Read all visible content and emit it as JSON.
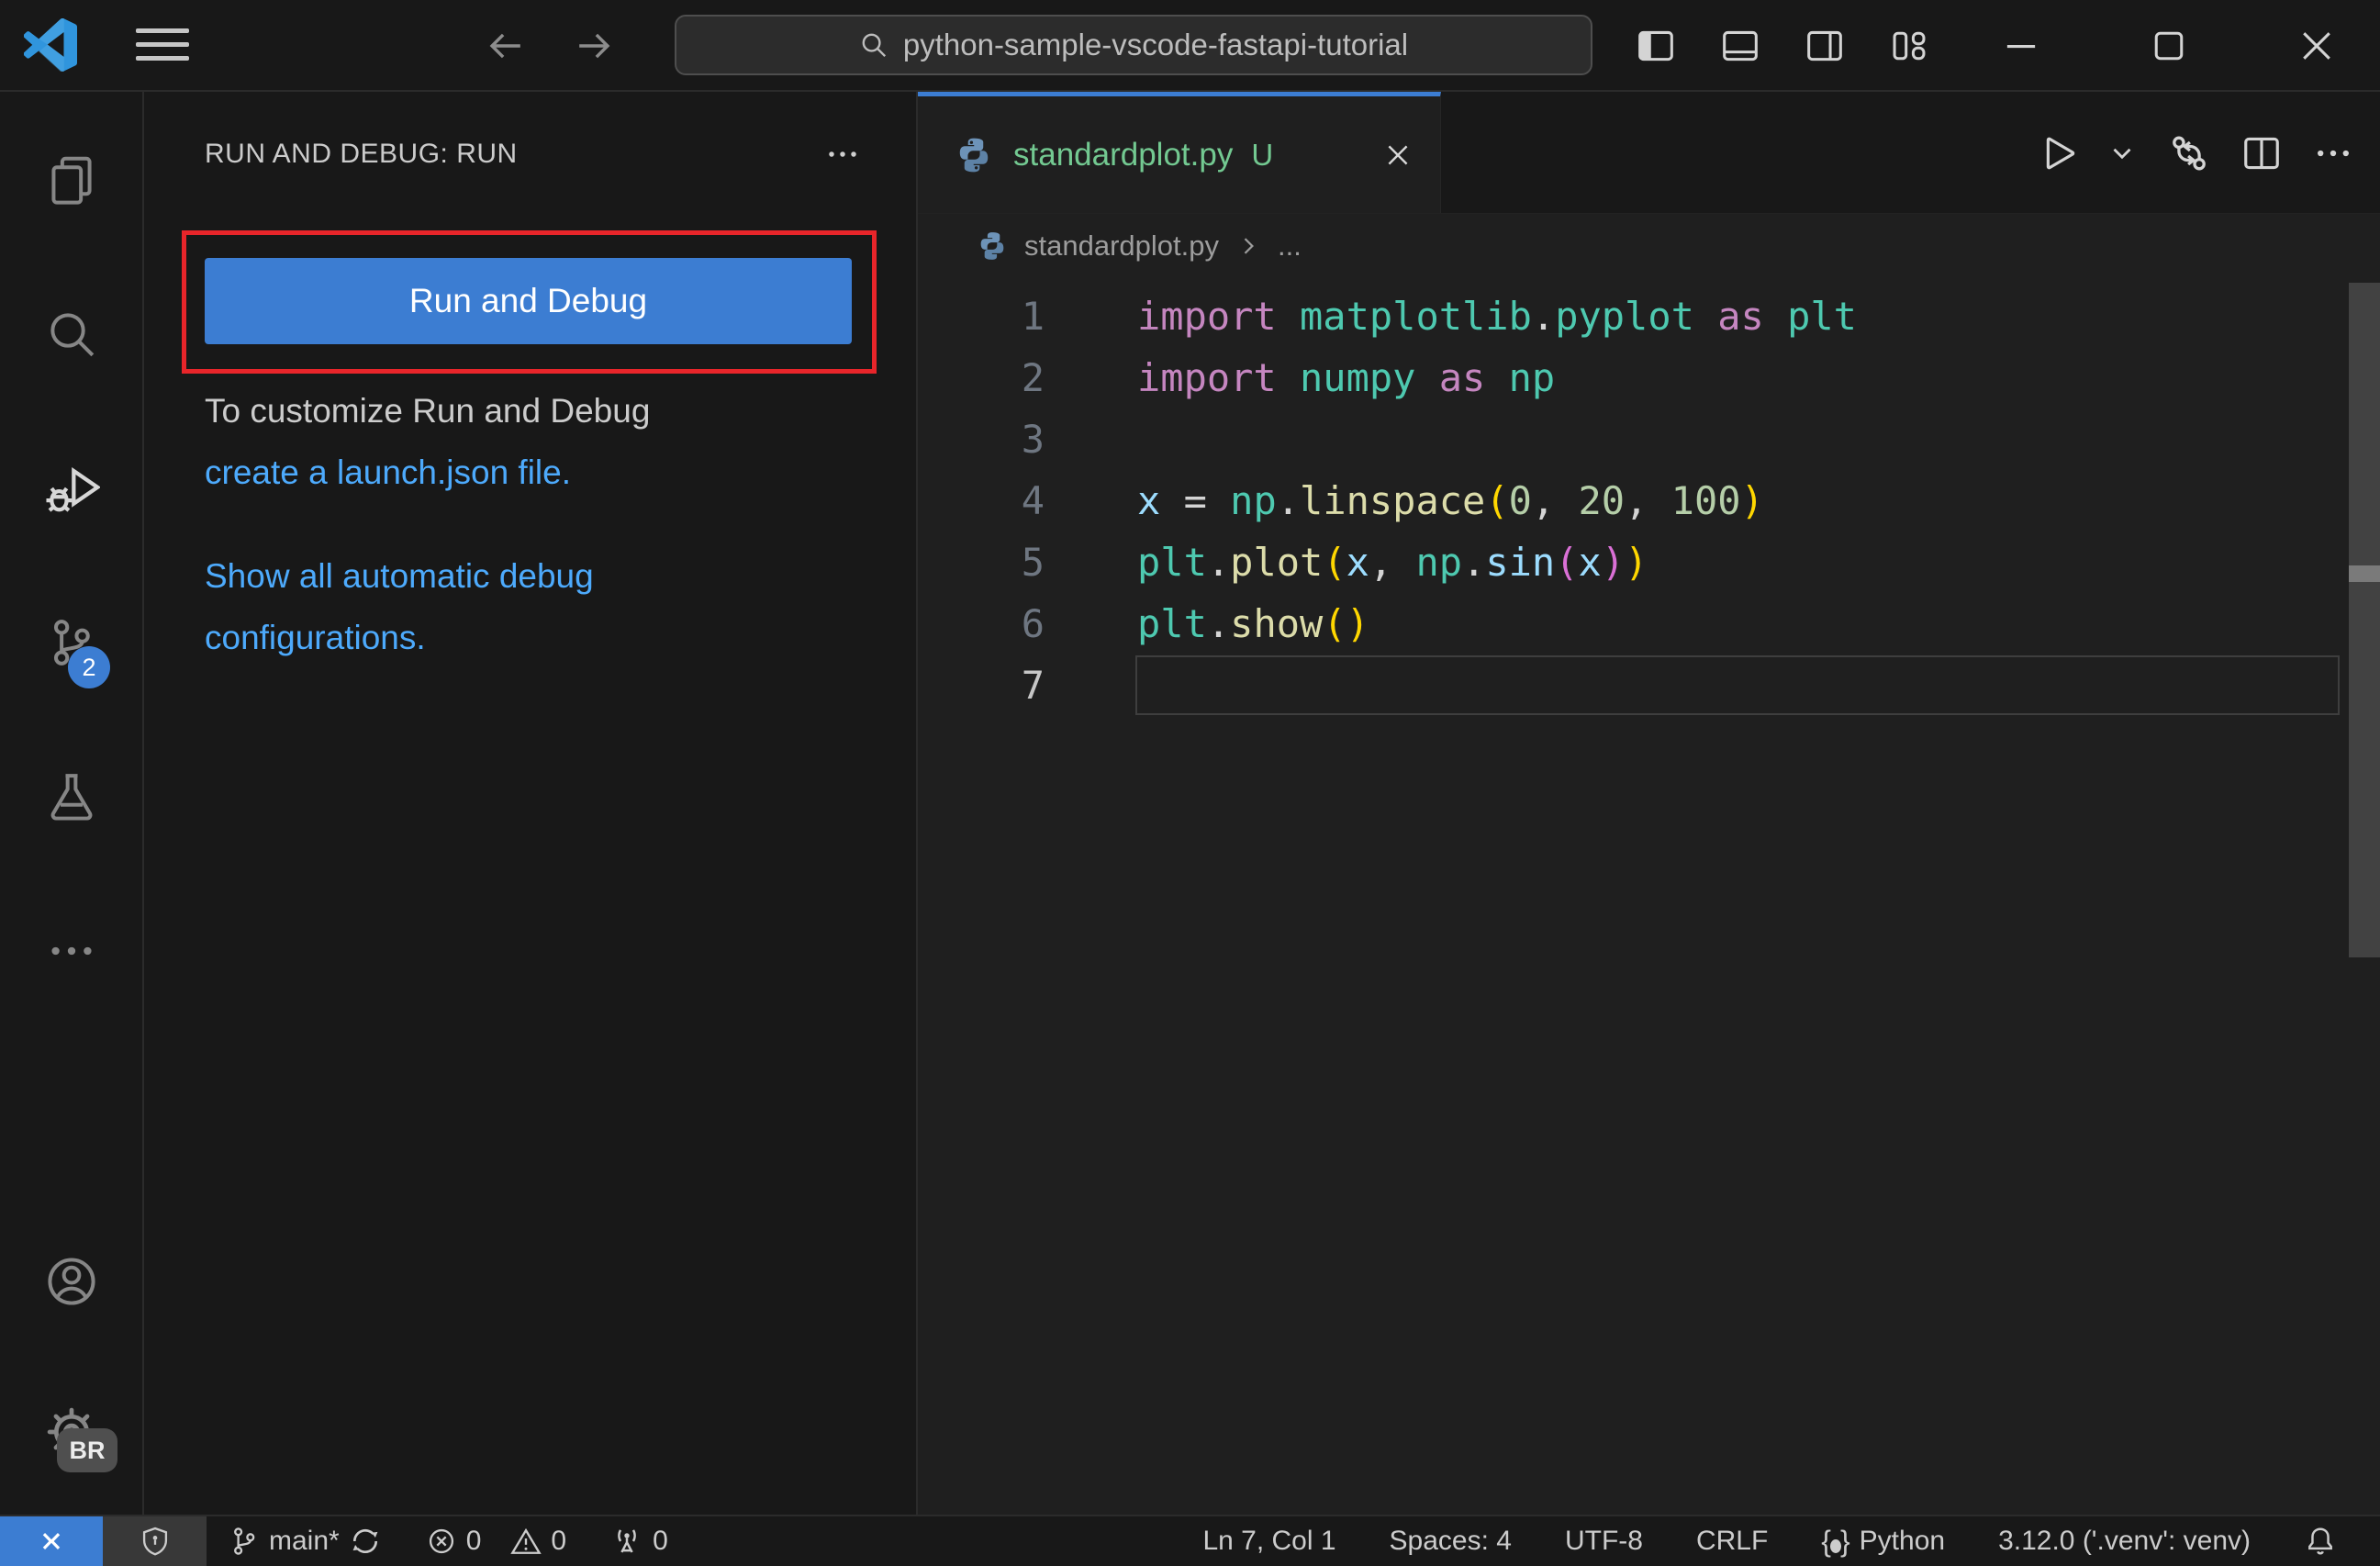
{
  "colors": {
    "accent_blue": "#3c7dd2",
    "annotation_red": "#e8252a",
    "untracked_green": "#73c991",
    "link_blue": "#4daafc",
    "titlebar_bg": "#181818",
    "editor_bg": "#1f1f1f"
  },
  "title_bar": {
    "search_value": "python-sample-vscode-fastapi-tutorial"
  },
  "activity_bar": {
    "items": [
      {
        "name": "explorer",
        "icon": "files-icon",
        "active": false
      },
      {
        "name": "search",
        "icon": "search-icon",
        "active": false
      },
      {
        "name": "run-and-debug",
        "icon": "debug-icon",
        "active": true
      },
      {
        "name": "source-control",
        "icon": "source-control-icon",
        "active": false,
        "badge": "2"
      },
      {
        "name": "testing",
        "icon": "beaker-icon",
        "active": false
      },
      {
        "name": "more-views",
        "icon": "ellipsis-icon",
        "active": false
      }
    ],
    "bottom_items": [
      {
        "name": "accounts",
        "icon": "account-icon"
      },
      {
        "name": "settings",
        "icon": "gear-icon",
        "badge": "BR"
      }
    ]
  },
  "sidebar": {
    "header": "RUN AND DEBUG: RUN",
    "run_button": "Run and Debug",
    "hint_text": "To customize Run and Debug",
    "launch_link": "create a launch.json file.",
    "show_configs_link": "Show all automatic debug configurations."
  },
  "editor": {
    "tab": {
      "file": "standardplot.py",
      "git_status": "U",
      "icon": "python-icon"
    },
    "breadcrumb": {
      "file": "standardplot.py",
      "symbol": "..."
    },
    "code": {
      "lines": [
        {
          "n": "1",
          "tokens": [
            [
              "kw",
              "import"
            ],
            [
              "pln",
              " "
            ],
            [
              "mod",
              "matplotlib"
            ],
            [
              "pln",
              "."
            ],
            [
              "mod",
              "pyplot"
            ],
            [
              "pln",
              " "
            ],
            [
              "kw",
              "as"
            ],
            [
              "pln",
              " "
            ],
            [
              "mod",
              "plt"
            ]
          ]
        },
        {
          "n": "2",
          "tokens": [
            [
              "kw",
              "import"
            ],
            [
              "pln",
              " "
            ],
            [
              "mod",
              "numpy"
            ],
            [
              "pln",
              " "
            ],
            [
              "kw",
              "as"
            ],
            [
              "pln",
              " "
            ],
            [
              "mod",
              "np"
            ]
          ]
        },
        {
          "n": "3",
          "tokens": []
        },
        {
          "n": "4",
          "tokens": [
            [
              "var",
              "x"
            ],
            [
              "pln",
              " = "
            ],
            [
              "mod",
              "np"
            ],
            [
              "pln",
              "."
            ],
            [
              "fn",
              "linspace"
            ],
            [
              "br1",
              "("
            ],
            [
              "num",
              "0"
            ],
            [
              "pln",
              ", "
            ],
            [
              "num",
              "20"
            ],
            [
              "pln",
              ", "
            ],
            [
              "num",
              "100"
            ],
            [
              "br1",
              ")"
            ]
          ]
        },
        {
          "n": "5",
          "tokens": [
            [
              "mod",
              "plt"
            ],
            [
              "pln",
              "."
            ],
            [
              "fn",
              "plot"
            ],
            [
              "br1",
              "("
            ],
            [
              "var",
              "x"
            ],
            [
              "pln",
              ", "
            ],
            [
              "mod",
              "np"
            ],
            [
              "pln",
              "."
            ],
            [
              "var",
              "sin"
            ],
            [
              "br2",
              "("
            ],
            [
              "var",
              "x"
            ],
            [
              "br2",
              ")"
            ],
            [
              "br1",
              ")"
            ]
          ]
        },
        {
          "n": "6",
          "tokens": [
            [
              "mod",
              "plt"
            ],
            [
              "pln",
              "."
            ],
            [
              "fn",
              "show"
            ],
            [
              "br1",
              "("
            ],
            [
              "br1",
              ")"
            ]
          ]
        },
        {
          "n": "7",
          "tokens": [],
          "cursor": true
        }
      ]
    }
  },
  "status_bar": {
    "branch": "main*",
    "errors": "0",
    "warnings": "0",
    "ports": "0",
    "cursor": "Ln 7, Col 1",
    "indent": "Spaces: 4",
    "encoding": "UTF-8",
    "eol": "CRLF",
    "language": "Python",
    "interpreter": "3.12.0 ('.venv': venv)"
  }
}
